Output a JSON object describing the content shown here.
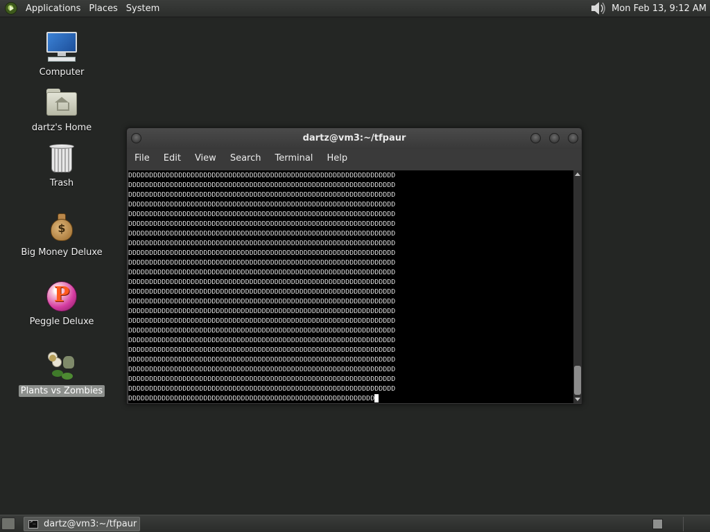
{
  "top_panel": {
    "menus": [
      "Applications",
      "Places",
      "System"
    ],
    "clock": "Mon Feb 13,  9:12 AM"
  },
  "desktop": {
    "icons": [
      {
        "label": "Computer",
        "icon": "computer-icon"
      },
      {
        "label": "dartz's Home",
        "icon": "home-folder-icon"
      },
      {
        "label": "Trash",
        "icon": "trash-icon"
      },
      {
        "label": "Big Money Deluxe",
        "icon": "money-bag-icon"
      },
      {
        "label": "Peggle Deluxe",
        "icon": "peggle-icon"
      },
      {
        "label": "Plants vs Zombies",
        "icon": "plants-vs-zombies-icon",
        "selected": true
      }
    ]
  },
  "terminal": {
    "title": "dartz@vm3:~/tfpaur",
    "menu": [
      "File",
      "Edit",
      "View",
      "Search",
      "Terminal",
      "Help"
    ],
    "rows": [
      "DDDDDDDDDDDDDDDDDDDDDDDDDDDDDDDDDDDDDDDDDDDDDDDDDDDDDDDDDDDDDDDD",
      "DDDDDDDDDDDDDDDDDDDDDDDDDDDDDDDDDDDDDDDDDDDDDDDDDDDDDDDDDDDDDDDD",
      "DDDDDDDDDDDDDDDDDDDDDDDDDDDDDDDDDDDDDDDDDDDDDDDDDDDDDDDDDDDDDDDD",
      "DDDDDDDDDDDDDDDDDDDDDDDDDDDDDDDDDDDDDDDDDDDDDDDDDDDDDDDDDDDDDDDD",
      "DDDDDDDDDDDDDDDDDDDDDDDDDDDDDDDDDDDDDDDDDDDDDDDDDDDDDDDDDDDDDDDD",
      "DDDDDDDDDDDDDDDDDDDDDDDDDDDDDDDDDDDDDDDDDDDDDDDDDDDDDDDDDDDDDDDD",
      "DDDDDDDDDDDDDDDDDDDDDDDDDDDDDDDDDDDDDDDDDDDDDDDDDDDDDDDDDDDDDDDD",
      "DDDDDDDDDDDDDDDDDDDDDDDDDDDDDDDDDDDDDDDDDDDDDDDDDDDDDDDDDDDDDDDD",
      "DDDDDDDDDDDDDDDDDDDDDDDDDDDDDDDDDDDDDDDDDDDDDDDDDDDDDDDDDDDDDDDD",
      "DDDDDDDDDDDDDDDDDDDDDDDDDDDDDDDDDDDDDDDDDDDDDDDDDDDDDDDDDDDDDDDD",
      "DDDDDDDDDDDDDDDDDDDDDDDDDDDDDDDDDDDDDDDDDDDDDDDDDDDDDDDDDDDDDDDD",
      "DDDDDDDDDDDDDDDDDDDDDDDDDDDDDDDDDDDDDDDDDDDDDDDDDDDDDDDDDDDDDDDD",
      "DDDDDDDDDDDDDDDDDDDDDDDDDDDDDDDDDDDDDDDDDDDDDDDDDDDDDDDDDDDDDDDD",
      "DDDDDDDDDDDDDDDDDDDDDDDDDDDDDDDDDDDDDDDDDDDDDDDDDDDDDDDDDDDDDDDD",
      "DDDDDDDDDDDDDDDDDDDDDDDDDDDDDDDDDDDDDDDDDDDDDDDDDDDDDDDDDDDDDDDD",
      "DDDDDDDDDDDDDDDDDDDDDDDDDDDDDDDDDDDDDDDDDDDDDDDDDDDDDDDDDDDDDDDD",
      "DDDDDDDDDDDDDDDDDDDDDDDDDDDDDDDDDDDDDDDDDDDDDDDDDDDDDDDDDDDDDDDD",
      "DDDDDDDDDDDDDDDDDDDDDDDDDDDDDDDDDDDDDDDDDDDDDDDDDDDDDDDDDDDDDDDD",
      "DDDDDDDDDDDDDDDDDDDDDDDDDDDDDDDDDDDDDDDDDDDDDDDDDDDDDDDDDDDDDDDD",
      "DDDDDDDDDDDDDDDDDDDDDDDDDDDDDDDDDDDDDDDDDDDDDDDDDDDDDDDDDDDDDDDD",
      "DDDDDDDDDDDDDDDDDDDDDDDDDDDDDDDDDDDDDDDDDDDDDDDDDDDDDDDDDDDDDDDD",
      "DDDDDDDDDDDDDDDDDDDDDDDDDDDDDDDDDDDDDDDDDDDDDDDDDDDDDDDDDDDDDDDD",
      "DDDDDDDDDDDDDDDDDDDDDDDDDDDDDDDDDDDDDDDDDDDDDDDDDDDDDDDDDDDDDDDD",
      "DDDDDDDDDDDDDDDDDDDDDDDDDDDDDDDDDDDDDDDDDDDDDDDDDDDDDDDDDDD"
    ]
  },
  "bottom_panel": {
    "task_label": "dartz@vm3:~/tfpaur"
  }
}
